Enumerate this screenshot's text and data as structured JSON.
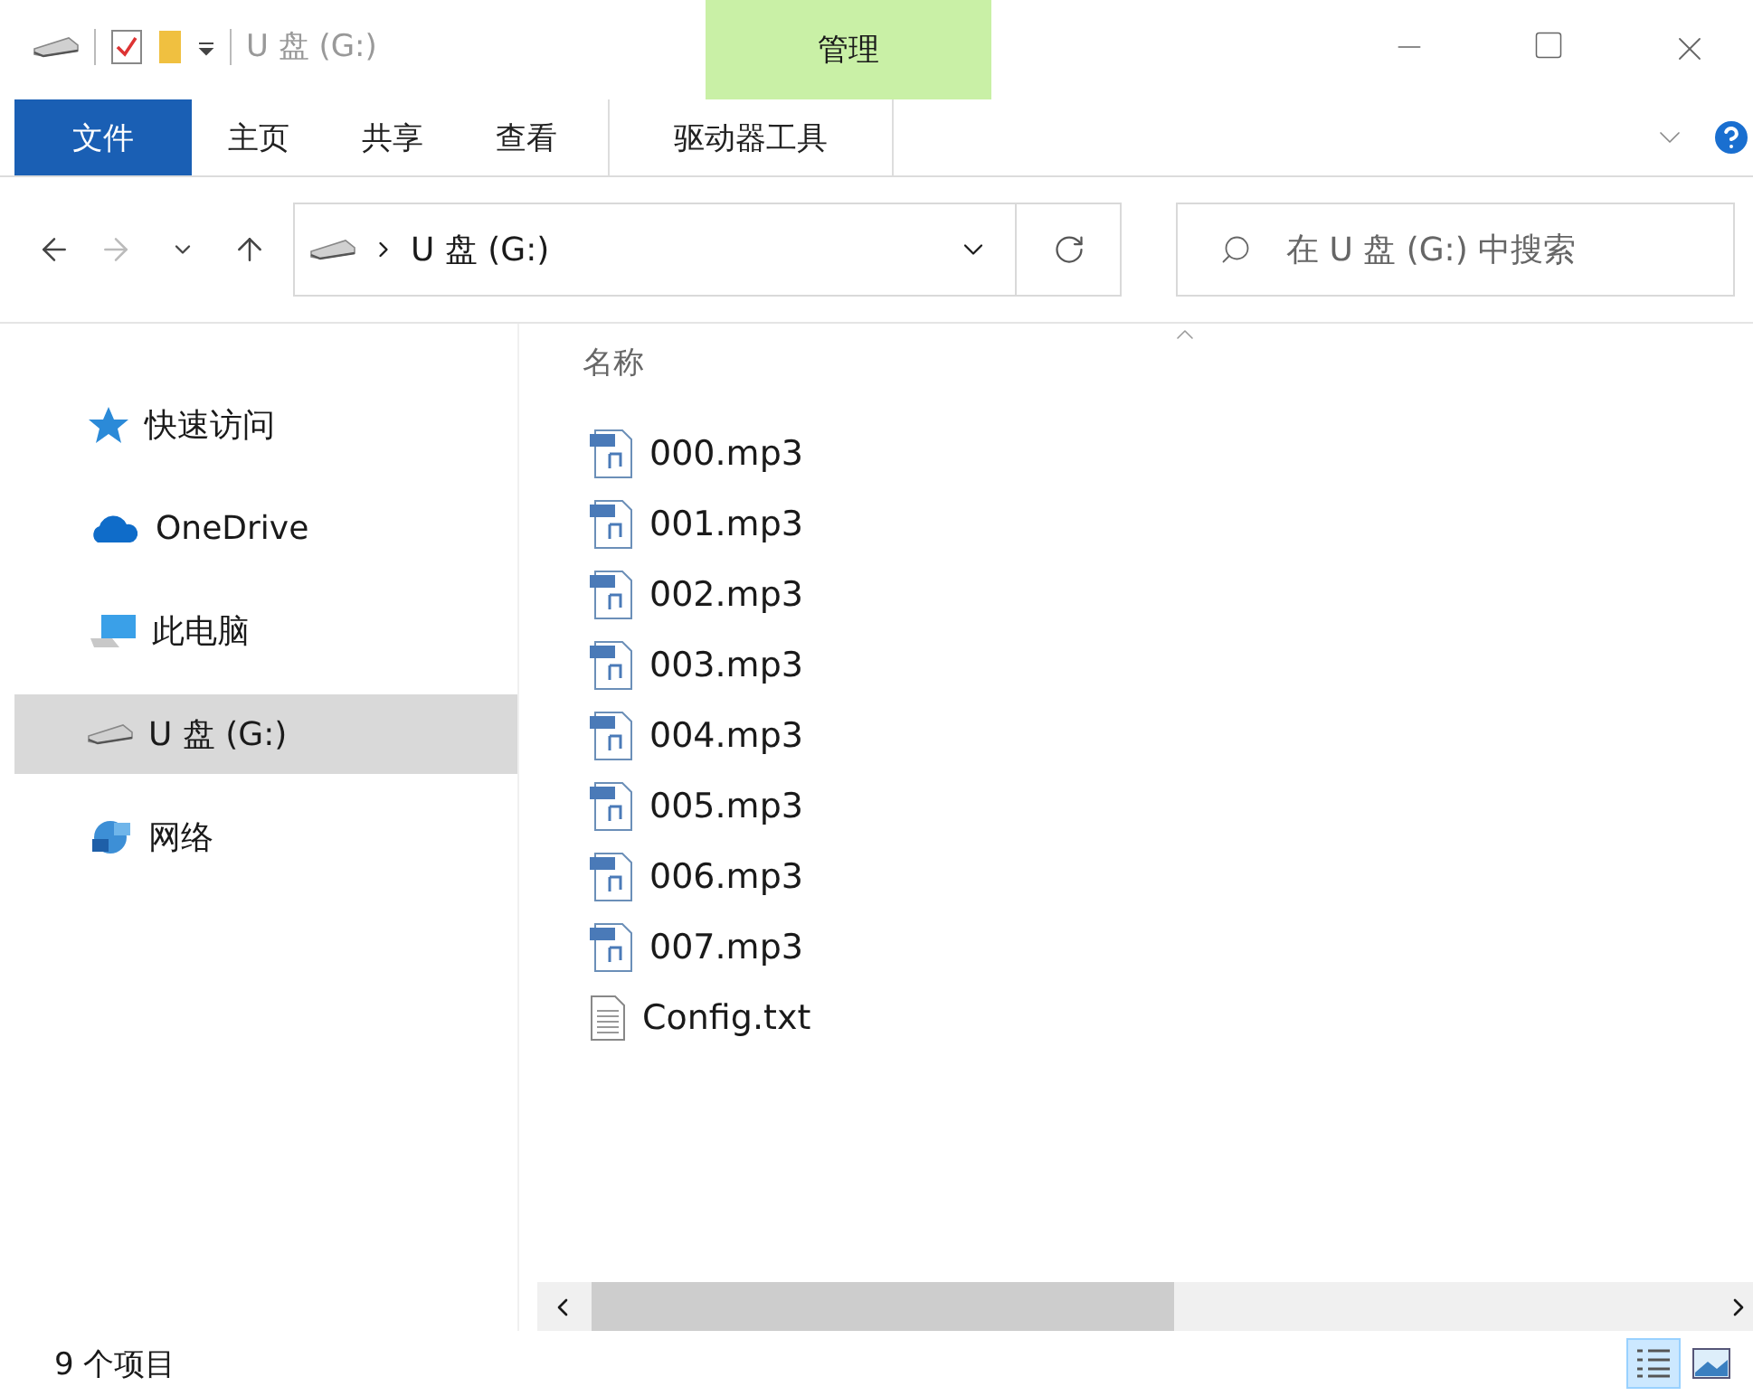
{
  "window": {
    "title": "U 盘 (G:)",
    "context_tab_group": "管理"
  },
  "ribbon_tabs": [
    {
      "label": "文件",
      "kind": "file"
    },
    {
      "label": "主页",
      "kind": "tab"
    },
    {
      "label": "共享",
      "kind": "tab"
    },
    {
      "label": "查看",
      "kind": "tab"
    },
    {
      "label": "驱动器工具",
      "kind": "context"
    }
  ],
  "navigation": {
    "forward_disabled": true,
    "address": "U 盘 (G:)",
    "search": {
      "placeholder": "在 U 盘 (G:) 中搜索"
    }
  },
  "sidebar": {
    "items": [
      {
        "label": "快速访问",
        "kind": "star",
        "selected": false
      },
      {
        "label": "OneDrive",
        "kind": "cloud",
        "selected": false
      },
      {
        "label": "此电脑",
        "kind": "computer",
        "selected": false
      },
      {
        "label": "U 盘 (G:)",
        "kind": "drive",
        "selected": true
      },
      {
        "label": "网络",
        "kind": "network",
        "selected": false
      }
    ]
  },
  "file_list": {
    "column": "名称",
    "files": [
      {
        "name": "000.mp3",
        "kind": "mp3"
      },
      {
        "name": "001.mp3",
        "kind": "mp3"
      },
      {
        "name": "002.mp3",
        "kind": "mp3"
      },
      {
        "name": "003.mp3",
        "kind": "mp3"
      },
      {
        "name": "004.mp3",
        "kind": "mp3"
      },
      {
        "name": "005.mp3",
        "kind": "mp3"
      },
      {
        "name": "006.mp3",
        "kind": "mp3"
      },
      {
        "name": "007.mp3",
        "kind": "mp3"
      },
      {
        "name": "Config.txt",
        "kind": "txt"
      }
    ]
  },
  "status_bar": {
    "count": "9 个项目",
    "views": [
      {
        "kind": "details",
        "selected": true
      },
      {
        "kind": "thumbnails",
        "selected": false
      }
    ]
  }
}
